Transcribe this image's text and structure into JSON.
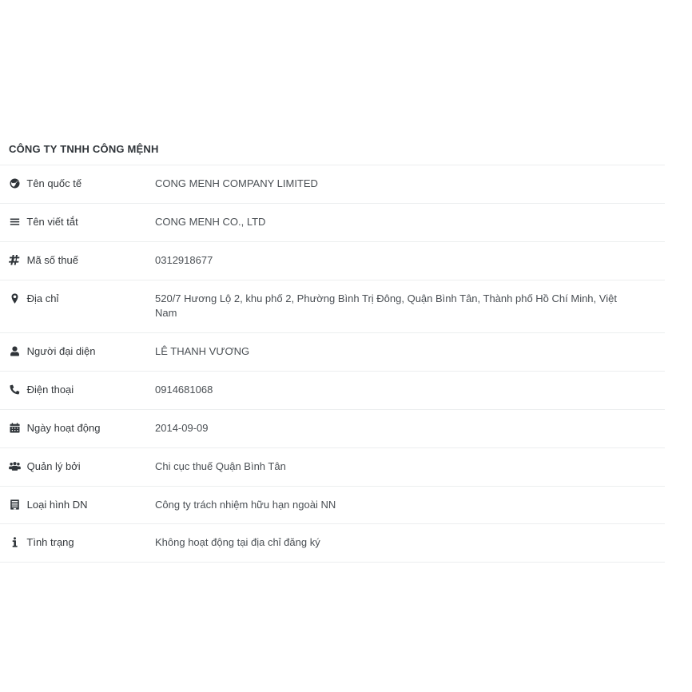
{
  "company": {
    "title": "CÔNG TY TNHH CÔNG MỆNH"
  },
  "colors": {
    "divider": "#eceeef",
    "label_text": "#34383c",
    "value_text": "#4a4f54",
    "title_text": "#2f3439",
    "background": "#ffffff"
  },
  "rows": [
    {
      "icon": "globe-icon",
      "label": "Tên quốc tế",
      "value": "CONG MENH COMPANY LIMITED"
    },
    {
      "icon": "list-icon",
      "label": "Tên viết tắt",
      "value": "CONG MENH CO., LTD"
    },
    {
      "icon": "hashtag-icon",
      "label": "Mã số thuế",
      "value": "0312918677"
    },
    {
      "icon": "map-marker-icon",
      "label": "Địa chỉ",
      "value": "520/7 Hương Lộ 2, khu phố 2, Phường Bình Trị Đông, Quận Bình Tân, Thành phố Hồ Chí Minh, Việt Nam"
    },
    {
      "icon": "user-icon",
      "label": "Người đại diện",
      "value": "LÊ THANH VƯƠNG"
    },
    {
      "icon": "phone-icon",
      "label": "Điện thoại",
      "value": "0914681068"
    },
    {
      "icon": "calendar-icon",
      "label": "Ngày hoạt động",
      "value": "2014-09-09"
    },
    {
      "icon": "users-icon",
      "label": "Quản lý bởi",
      "value": "Chi cục thuế Quận Bình Tân"
    },
    {
      "icon": "building-icon",
      "label": "Loại hình DN",
      "value": "Công ty trách nhiệm hữu hạn ngoài NN"
    },
    {
      "icon": "info-icon",
      "label": "Tình trạng",
      "value": "Không hoạt động tại địa chỉ đăng ký"
    }
  ]
}
